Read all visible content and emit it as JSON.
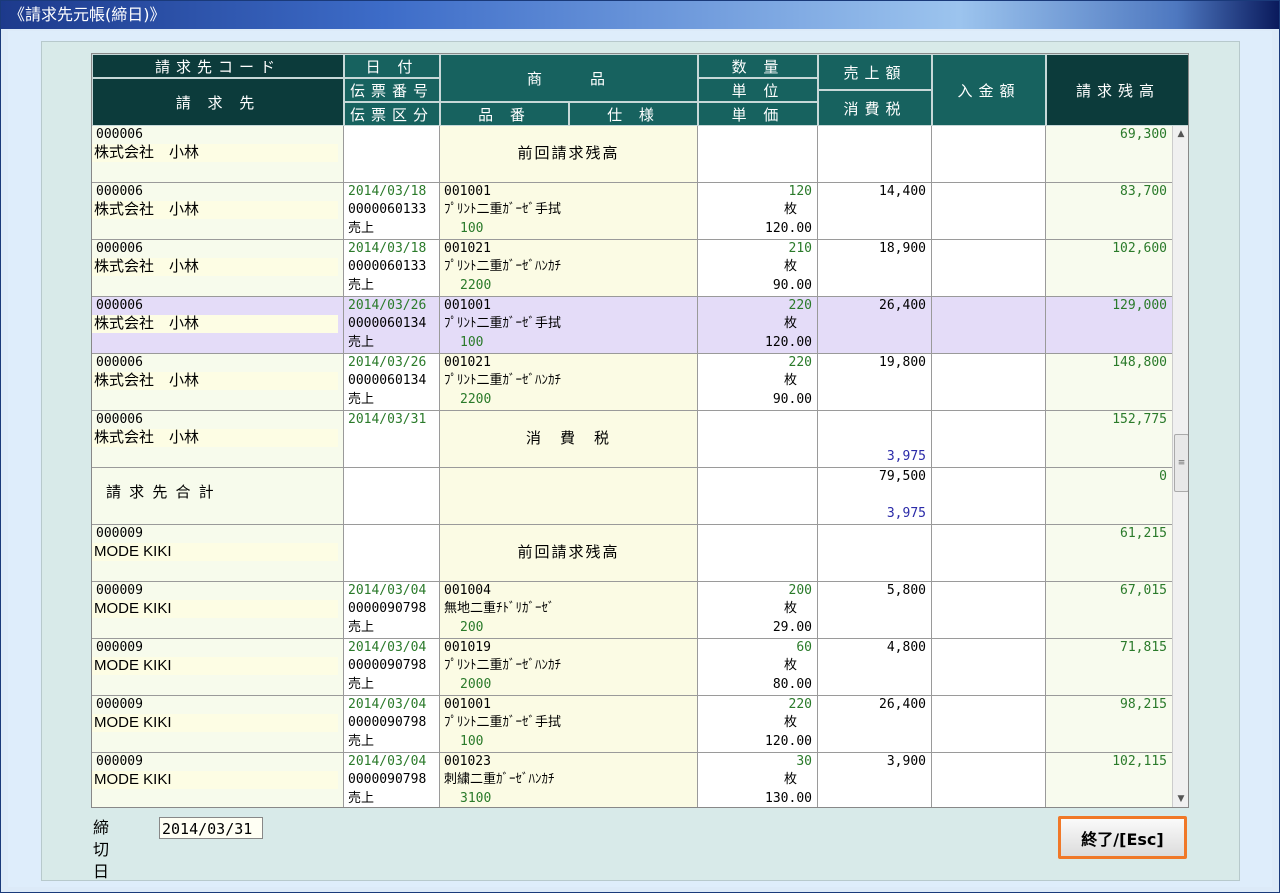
{
  "window": {
    "title": "《請求先元帳(締日)》"
  },
  "headers": {
    "customer_code": "請求先コード",
    "customer": "請 求 先",
    "date": "日 付",
    "slip_no": "伝票番号",
    "slip_type": "伝票区分",
    "product": "商　　品",
    "product_no": "品 番",
    "spec": "仕 様",
    "quantity": "数 量",
    "unit": "単 位",
    "unit_price": "単 価",
    "sales": "売上額",
    "tax": "消費税",
    "payment": "入金額",
    "balance": "請求残高"
  },
  "rows": [
    {
      "code": "000006",
      "name": "株式会社　小林",
      "date": "",
      "slip": "",
      "type": "",
      "product_code": "",
      "product_name": "前回請求残高",
      "product_sub": "",
      "qty": "",
      "unit": "",
      "price": "",
      "sales": "",
      "tax": "",
      "balance": "69,300",
      "selected": false
    },
    {
      "code": "000006",
      "name": "株式会社　小林",
      "date": "2014/03/18",
      "slip": "0000060133",
      "type": "売上",
      "product_code": "001001",
      "product_name": "ﾌﾟﾘﾝﾄ二重ｶﾞｰｾﾞ手拭",
      "product_sub": "100",
      "qty": "120",
      "unit": "枚",
      "price": "120.00",
      "sales": "14,400",
      "tax": "",
      "balance": "83,700",
      "selected": false
    },
    {
      "code": "000006",
      "name": "株式会社　小林",
      "date": "2014/03/18",
      "slip": "0000060133",
      "type": "売上",
      "product_code": "001021",
      "product_name": "ﾌﾟﾘﾝﾄ二重ｶﾞｰｾﾞﾊﾝｶﾁ",
      "product_sub": "2200",
      "qty": "210",
      "unit": "枚",
      "price": "90.00",
      "sales": "18,900",
      "tax": "",
      "balance": "102,600",
      "selected": false
    },
    {
      "code": "000006",
      "name": "株式会社　小林",
      "date": "2014/03/26",
      "slip": "0000060134",
      "type": "売上",
      "product_code": "001001",
      "product_name": "ﾌﾟﾘﾝﾄ二重ｶﾞｰｾﾞ手拭",
      "product_sub": "100",
      "qty": "220",
      "unit": "枚",
      "price": "120.00",
      "sales": "26,400",
      "tax": "",
      "balance": "129,000",
      "selected": true
    },
    {
      "code": "000006",
      "name": "株式会社　小林",
      "date": "2014/03/26",
      "slip": "0000060134",
      "type": "売上",
      "product_code": "001021",
      "product_name": "ﾌﾟﾘﾝﾄ二重ｶﾞｰｾﾞﾊﾝｶﾁ",
      "product_sub": "2200",
      "qty": "220",
      "unit": "枚",
      "price": "90.00",
      "sales": "19,800",
      "tax": "",
      "balance": "148,800",
      "selected": false
    },
    {
      "code": "000006",
      "name": "株式会社　小林",
      "date": "2014/03/31",
      "slip": "",
      "type": "",
      "product_code": "",
      "product_name": "消　費　税",
      "product_sub": "",
      "qty": "",
      "unit": "",
      "price": "",
      "sales": "",
      "tax": "3,975",
      "balance": "152,775",
      "selected": false
    },
    {
      "code": "",
      "name": "請 求 先 合 計",
      "date": "",
      "slip": "",
      "type": "",
      "product_code": "",
      "product_name": "",
      "product_sub": "",
      "qty": "",
      "unit": "",
      "price": "",
      "sales": "79,500",
      "tax": "3,975",
      "balance": "0",
      "selected": false,
      "total": true
    },
    {
      "code": "000009",
      "name": "MODE KIKI",
      "date": "",
      "slip": "",
      "type": "",
      "product_code": "",
      "product_name": "前回請求残高",
      "product_sub": "",
      "qty": "",
      "unit": "",
      "price": "",
      "sales": "",
      "tax": "",
      "balance": "61,215",
      "selected": false
    },
    {
      "code": "000009",
      "name": "MODE KIKI",
      "date": "2014/03/04",
      "slip": "0000090798",
      "type": "売上",
      "product_code": "001004",
      "product_name": "無地二重ﾁﾄﾞﾘｶﾞｰｾﾞ",
      "product_sub": "200",
      "qty": "200",
      "unit": "枚",
      "price": "29.00",
      "sales": "5,800",
      "tax": "",
      "balance": "67,015",
      "selected": false
    },
    {
      "code": "000009",
      "name": "MODE KIKI",
      "date": "2014/03/04",
      "slip": "0000090798",
      "type": "売上",
      "product_code": "001019",
      "product_name": "ﾌﾟﾘﾝﾄ二重ｶﾞｰｾﾞﾊﾝｶﾁ",
      "product_sub": "2000",
      "qty": "60",
      "unit": "枚",
      "price": "80.00",
      "sales": "4,800",
      "tax": "",
      "balance": "71,815",
      "selected": false
    },
    {
      "code": "000009",
      "name": "MODE KIKI",
      "date": "2014/03/04",
      "slip": "0000090798",
      "type": "売上",
      "product_code": "001001",
      "product_name": "ﾌﾟﾘﾝﾄ二重ｶﾞｰｾﾞ手拭",
      "product_sub": "100",
      "qty": "220",
      "unit": "枚",
      "price": "120.00",
      "sales": "26,400",
      "tax": "",
      "balance": "98,215",
      "selected": false
    },
    {
      "code": "000009",
      "name": "MODE KIKI",
      "date": "2014/03/04",
      "slip": "0000090798",
      "type": "売上",
      "product_code": "001023",
      "product_name": "刺繍二重ｶﾞｰｾﾞﾊﾝｶﾁ",
      "product_sub": "3100",
      "qty": "30",
      "unit": "枚",
      "price": "130.00",
      "sales": "3,900",
      "tax": "",
      "balance": "102,115",
      "selected": false
    }
  ],
  "footer": {
    "closing_label": "締切日",
    "closing_date": "2014/03/31",
    "end_button": "終了/[Esc]"
  },
  "colors": {
    "header": "#0b4a4a",
    "selected_row": "#e4dcf8",
    "accent_border": "#f07828"
  }
}
